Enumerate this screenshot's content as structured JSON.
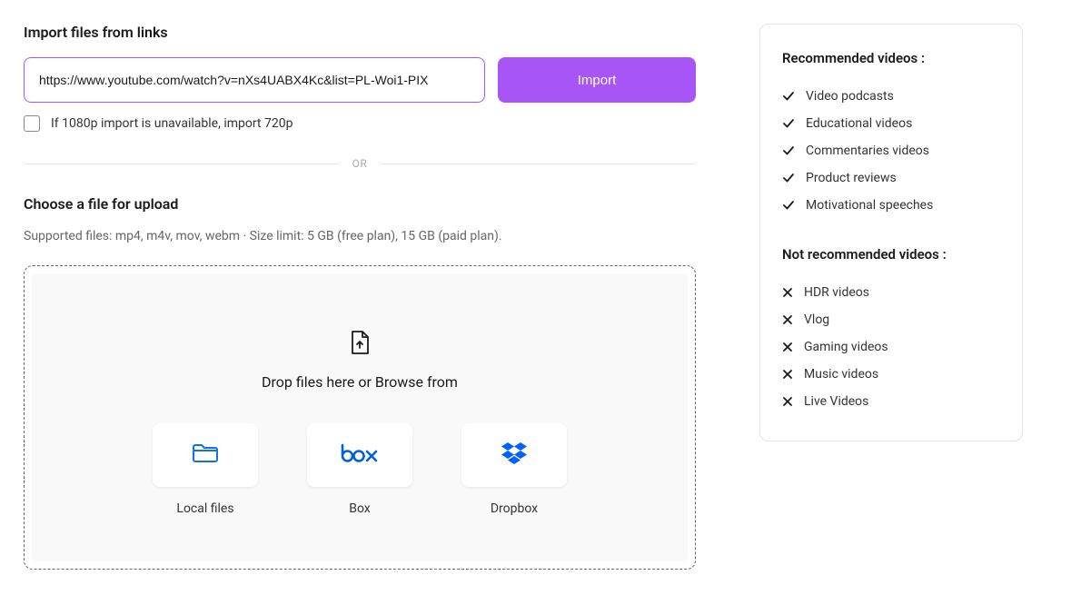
{
  "import": {
    "title": "Import files from links",
    "url_value": "https://www.youtube.com/watch?v=nXs4UABX4Kc&list=PL-Woi1-PIX",
    "button_label": "Import",
    "checkbox_label": "If 1080p import is unavailable, import 720p"
  },
  "divider_text": "OR",
  "upload": {
    "title": "Choose a file for upload",
    "subtitle": "Supported files: mp4, m4v, mov, webm   ·   Size limit: 5 GB (free plan), 15 GB (paid plan).",
    "drop_text": "Drop files here or Browse from",
    "providers": [
      {
        "label": "Local files"
      },
      {
        "label": "Box"
      },
      {
        "label": "Dropbox"
      }
    ]
  },
  "sidebar": {
    "recommended_title": "Recommended videos :",
    "recommended_items": [
      "Video podcasts",
      "Educational videos",
      "Commentaries videos",
      "Product reviews",
      "Motivational speeches"
    ],
    "not_recommended_title": "Not recommended videos :",
    "not_recommended_items": [
      "HDR videos",
      "Vlog",
      "Gaming videos",
      "Music videos",
      "Live Videos"
    ]
  }
}
